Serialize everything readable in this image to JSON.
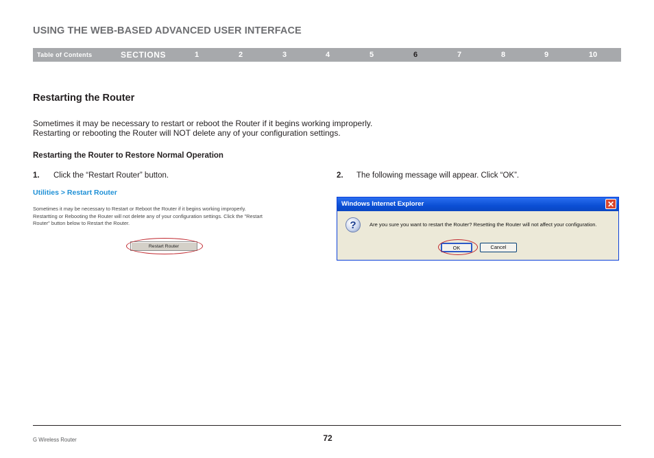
{
  "header": {
    "title": "USING THE WEB-BASED ADVANCED USER INTERFACE"
  },
  "nav": {
    "toc_label": "Table of Contents",
    "sections_label": "SECTIONS",
    "numbers": [
      "1",
      "2",
      "3",
      "4",
      "5",
      "6",
      "7",
      "8",
      "9",
      "10"
    ],
    "active": "6"
  },
  "section": {
    "title": "Restarting the Router",
    "intro_line1": "Sometimes it may be necessary to restart or reboot the Router if it begins working improperly.",
    "intro_line2": "Restarting or rebooting the Router will NOT delete any of your configuration settings.",
    "subtitle": "Restarting the Router to Restore Normal Operation"
  },
  "step1": {
    "number": "1.",
    "text": "Click the “Restart Router” button.",
    "breadcrumb": "Utilities > Restart Router",
    "panel_line1": "Sometimes it may be necessary to Restart or Reboot the Router if it begins working improperly.",
    "panel_line2": "Restartting or Rebooting the Router will not delete any of your configuration settings. Click the \"Restart",
    "panel_line3": "Router\" button below to Restart the Router.",
    "button_label": "Restart Router"
  },
  "step2": {
    "number": "2.",
    "text": "The following message will appear. Click “OK”.",
    "dialog": {
      "title": "Windows Internet Explorer",
      "close_glyph": "✕",
      "icon_glyph": "?",
      "message": "Are you sure you want to restart the Router? Resetting the Router will not affect your configuration.",
      "ok_label": "OK",
      "cancel_label": "Cancel"
    }
  },
  "footer": {
    "product": "G Wireless Router",
    "page_number": "72"
  },
  "colors": {
    "nav_bar": "#a7a9ac",
    "breadcrumb": "#1e90d6",
    "highlight_ellipse": "#c0262d",
    "dialog_title": "#0b4fd4"
  }
}
